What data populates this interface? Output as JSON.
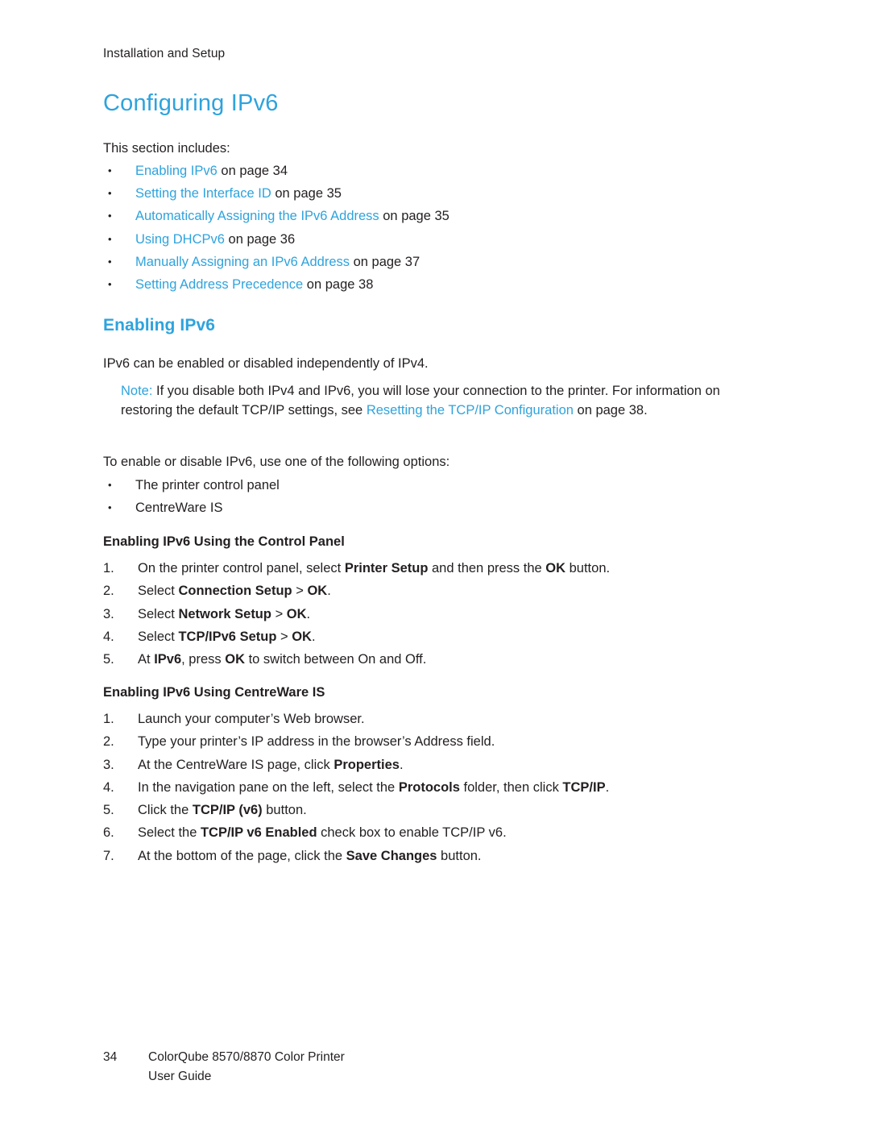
{
  "colors": {
    "link": "#2ea3dd",
    "text": "#231f20"
  },
  "header": {
    "running_head": "Installation and Setup"
  },
  "title": "Configuring IPv6",
  "intro": "This section includes:",
  "toc": [
    {
      "link": "Enabling IPv6",
      "tail": " on page 34"
    },
    {
      "link": "Setting the Interface ID",
      "tail": " on page 35"
    },
    {
      "link": "Automatically Assigning the IPv6 Address",
      "tail": " on page 35"
    },
    {
      "link": "Using DHCPv6",
      "tail": " on page 36"
    },
    {
      "link": "Manually Assigning an IPv6 Address",
      "tail": " on page 37"
    },
    {
      "link": "Setting Address Precedence",
      "tail": " on page 38"
    }
  ],
  "section": {
    "heading": "Enabling IPv6",
    "para1": "IPv6 can be enabled or disabled independently of IPv4.",
    "note": {
      "label": "Note:",
      "part1": " If you disable both IPv4 and IPv6, you will lose your connection to the printer. For information on restoring the default TCP/IP settings, see ",
      "link": "Resetting the TCP/IP Configuration",
      "part2": " on page 38."
    },
    "para2": "To enable or disable IPv6, use one of the following options:",
    "options": [
      "The printer control panel",
      "CentreWare IS"
    ]
  },
  "control_panel": {
    "heading": "Enabling IPv6 Using the Control Panel",
    "steps": [
      {
        "num": "1.",
        "html": "On the printer control panel, select <b>Printer Setup</b> and then press the <b>OK</b> button."
      },
      {
        "num": "2.",
        "html": "Select <b>Connection Setup</b> &gt; <b>OK</b>."
      },
      {
        "num": "3.",
        "html": "Select <b>Network Setup</b> &gt; <b>OK</b>."
      },
      {
        "num": "4.",
        "html": "Select <b>TCP/IPv6 Setup</b> &gt; <b>OK</b>."
      },
      {
        "num": "5.",
        "html": "At <b>IPv6</b>, press <b>OK</b> to switch between On and Off."
      }
    ]
  },
  "centreware": {
    "heading": "Enabling IPv6 Using CentreWare IS",
    "steps": [
      {
        "num": "1.",
        "html": "Launch your computer’s Web browser."
      },
      {
        "num": "2.",
        "html": "Type your printer’s IP address in the browser’s Address field."
      },
      {
        "num": "3.",
        "html": "At the CentreWare IS page, click <b>Properties</b>."
      },
      {
        "num": "4.",
        "html": "In the navigation pane on the left, select the <b>Protocols</b> folder, then click <b>TCP/IP</b>."
      },
      {
        "num": "5.",
        "html": "Click the <b>TCP/IP (v6)</b> button."
      },
      {
        "num": "6.",
        "html": "Select the <b>TCP/IP v6 Enabled</b> check box to enable TCP/IP v6."
      },
      {
        "num": "7.",
        "html": "At the bottom of the page, click the <b>Save Changes</b> button."
      }
    ]
  },
  "footer": {
    "page_number": "34",
    "line1": "ColorQube 8570/8870 Color Printer",
    "line2": "User Guide"
  }
}
